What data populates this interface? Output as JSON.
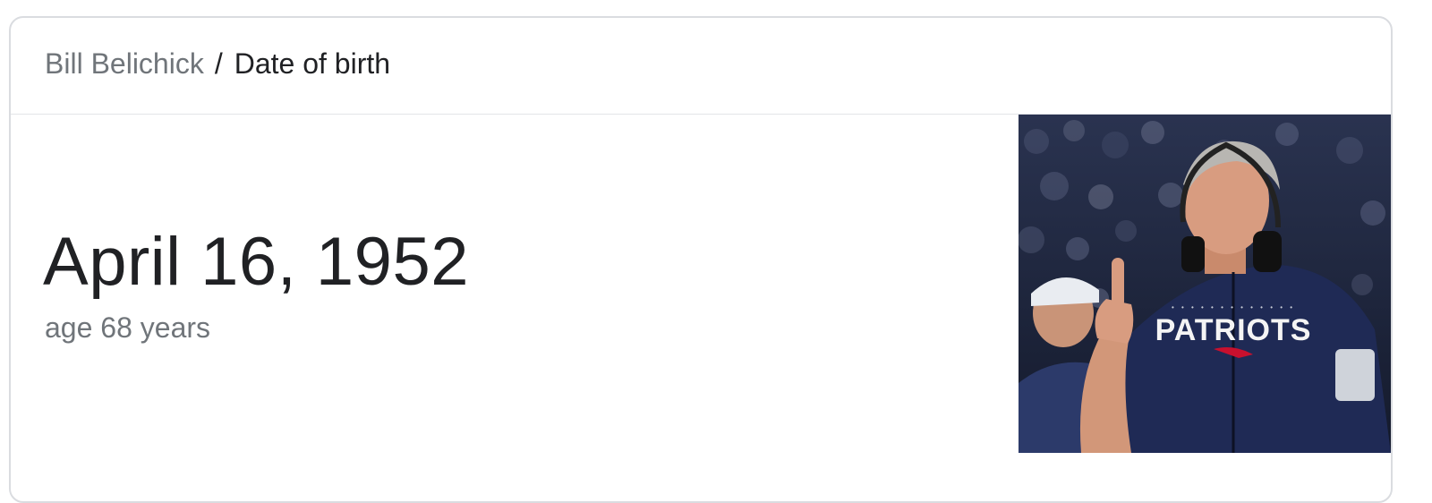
{
  "breadcrumb": {
    "entity": "Bill Belichick",
    "separator": "/",
    "attribute": "Date of birth"
  },
  "answer": {
    "value": "April 16, 1952",
    "subtext": "age 68 years"
  },
  "photo": {
    "shirt_text": "PATRIOTS",
    "colors": {
      "shirt": "#1f2a55",
      "crowd": "#1b2236",
      "skin": "#d89c80"
    }
  }
}
